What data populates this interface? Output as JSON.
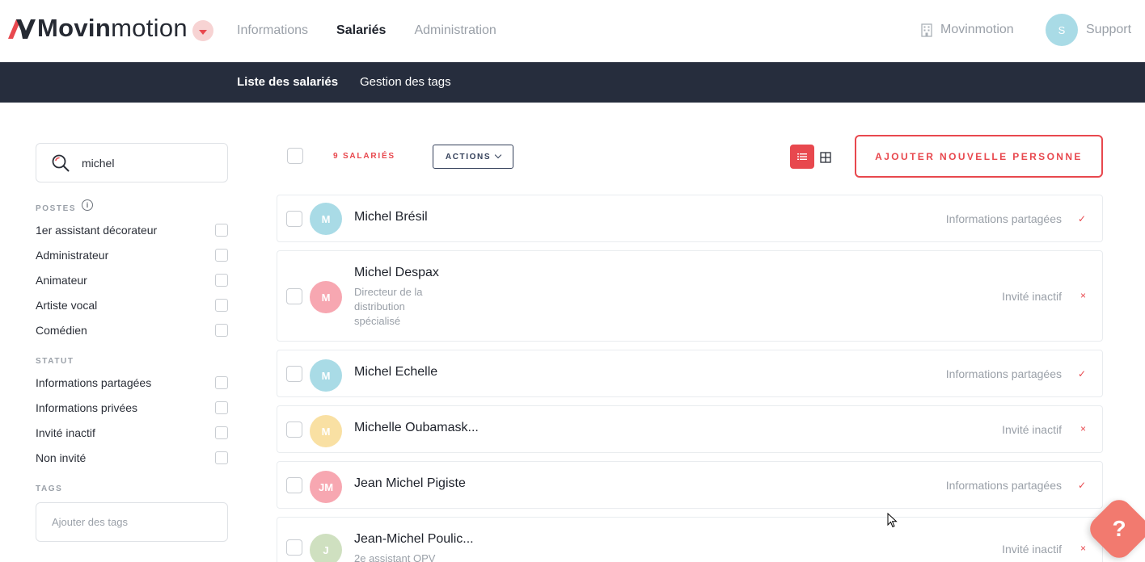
{
  "app": {
    "logo_bold": "Movin",
    "logo_light": "motion"
  },
  "nav": {
    "items": [
      {
        "label": "Informations",
        "active": false
      },
      {
        "label": "Salariés",
        "active": true
      },
      {
        "label": "Administration",
        "active": false
      }
    ],
    "organization": "Movinmotion",
    "support_avatar": "S",
    "support_label": "Support"
  },
  "subnav": {
    "items": [
      {
        "label": "Liste des salariés",
        "active": true
      },
      {
        "label": "Gestion des tags",
        "active": false
      }
    ]
  },
  "filters": {
    "search_value": "michel",
    "postes_title": "POSTES",
    "postes": [
      "1er assistant décorateur",
      "Administrateur",
      "Animateur",
      "Artiste vocal",
      "Comédien"
    ],
    "statut_title": "STATUT",
    "statuts": [
      "Informations partagées",
      "Informations privées",
      "Invité inactif",
      "Non invité"
    ],
    "tags_title": "TAGS",
    "tags_placeholder": "Ajouter des tags"
  },
  "toolbar": {
    "count_label": "9 SALARIÉS",
    "actions_label": "ACTIONS",
    "add_label": "AJOUTER NOUVELLE PERSONNE"
  },
  "people": [
    {
      "initials": "M",
      "name": "Michel Brésil",
      "job": "",
      "status": "Informations partagées",
      "mark": "✓",
      "color": "#a9dbe6"
    },
    {
      "initials": "M",
      "name": "Michel Despax",
      "job": "Directeur de la distribution spécialisé",
      "status": "Invité inactif",
      "mark": "×",
      "color": "#f7a7b1"
    },
    {
      "initials": "M",
      "name": "Michel Echelle",
      "job": "",
      "status": "Informations partagées",
      "mark": "✓",
      "color": "#a9dbe6"
    },
    {
      "initials": "M",
      "name": "Michelle Oubamask...",
      "job": "",
      "status": "Invité inactif",
      "mark": "×",
      "color": "#f9e0a3"
    },
    {
      "initials": "JM",
      "name": "Jean Michel Pigiste",
      "job": "",
      "status": "Informations partagées",
      "mark": "✓",
      "color": "#f7a7b1"
    },
    {
      "initials": "J",
      "name": "Jean-Michel Poulic...",
      "job": "2e assistant OPV",
      "status": "Invité inactif",
      "mark": "×",
      "color": "#cfe0c0"
    }
  ],
  "help": {
    "label": "?"
  },
  "colors": {
    "accent": "#e8484e",
    "navy": "#262d3d"
  }
}
